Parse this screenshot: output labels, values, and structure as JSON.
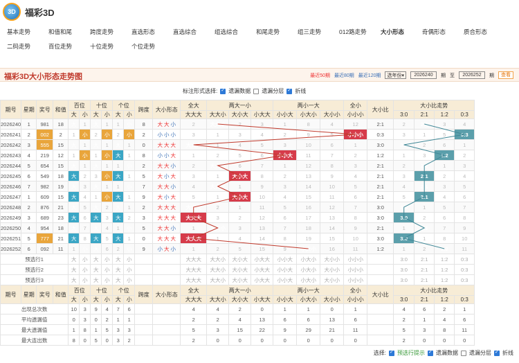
{
  "brand": {
    "logo": "3D",
    "name": "福彩3D"
  },
  "nav": [
    "基本走势",
    "和值和尾",
    "跨度走势",
    "直选形态",
    "直选综合",
    "组选综合",
    "和尾走势",
    "组三走势",
    "012路走势",
    "大小形态",
    "奇偶形态",
    "质合形态",
    "二码走势",
    "百位走势",
    "十位走势",
    "个位走势"
  ],
  "nav_active": 9,
  "page_title": "福彩3D大小形态走势图",
  "filters": {
    "recent50": "最近50期",
    "recent80": "最近80期",
    "recent120": "最近120期",
    "select": "选年份",
    "from": "2026240",
    "qi1": "期",
    "to_label": "至",
    "to": "2026252",
    "qi2": "期",
    "query": "查看"
  },
  "label_form": {
    "label": "标注形式选择:",
    "opt1": "遗漏数据",
    "opt2": "遗漏分层",
    "opt3": "折线"
  },
  "header": {
    "issue": "期号",
    "week": "星期",
    "prize": "奖号",
    "sum": "和值",
    "hundred": "百位",
    "ten": "十位",
    "unit": "个位",
    "span": "跨度",
    "shape": "大小形态",
    "all_big": "全大",
    "two_big_one_small": "两大一小",
    "two_small_one_big": "两小一大",
    "all_small": "全小",
    "ratio": "大小比",
    "ratio_trend": "大小比走势",
    "big": "大",
    "small": "小"
  },
  "shape_cols": [
    "大大大",
    "大大小",
    "大小大",
    "小大大",
    "小小大",
    "小大小",
    "大小小",
    "小小小"
  ],
  "ratio_cols": [
    "3:0",
    "2:1",
    "1:2",
    "0:3"
  ],
  "rows": [
    {
      "issue": "2026240",
      "week": "1",
      "prize": "981",
      "sum": "18",
      "h": [
        "大",
        "1"
      ],
      "t": [
        "大",
        "1"
      ],
      "u": [
        "1",
        "小"
      ],
      "span": "8",
      "shape": [
        "大",
        "大",
        "小"
      ],
      "sc": [
        "2",
        "大大小",
        "2",
        "3",
        "1",
        "8",
        "4",
        "12"
      ],
      "ratio": "2:1",
      "rt": [
        "2",
        "2:1",
        "3",
        "4"
      ]
    },
    {
      "issue": "2026241",
      "week": "2",
      "prize": "002",
      "sum": "2",
      "h": [
        "1",
        "小"
      ],
      "t": [
        "2",
        "小"
      ],
      "u": [
        "2",
        "小"
      ],
      "span": "2",
      "shape": [
        "小",
        "小",
        "小"
      ],
      "sc": [
        "3",
        "1",
        "3",
        "4",
        "2",
        "9",
        "5",
        "小小小"
      ],
      "ratio": "0:3",
      "rt": [
        "3",
        "1",
        "5",
        "0:3"
      ]
    },
    {
      "issue": "2026242",
      "week": "3",
      "prize": "555",
      "sum": "15",
      "h": [
        "大",
        "1"
      ],
      "t": [
        "大",
        "1"
      ],
      "u": [
        "大",
        "1"
      ],
      "span": "0",
      "shape": [
        "大",
        "大",
        "大"
      ],
      "sc": [
        "大大大",
        "1",
        "4",
        "5",
        "3",
        "10",
        "6",
        "1"
      ],
      "ratio": "3:0",
      "rt": [
        "3:0",
        "2",
        "6",
        "1"
      ]
    },
    {
      "issue": "2026243",
      "week": "4",
      "prize": "219",
      "sum": "12",
      "h": [
        "1",
        "小"
      ],
      "t": [
        "1",
        "小"
      ],
      "u": [
        "大",
        "1"
      ],
      "span": "8",
      "shape": [
        "小",
        "小",
        "大"
      ],
      "sc": [
        "1",
        "2",
        "5",
        "6",
        "小小大",
        "11",
        "7",
        "2"
      ],
      "ratio": "1:2",
      "rt": [
        "1",
        "3",
        "1:2",
        "2"
      ]
    },
    {
      "issue": "2026244",
      "week": "5",
      "prize": "654",
      "sum": "15",
      "h": [
        "大",
        "1"
      ],
      "t": [
        "大",
        "1"
      ],
      "u": [
        "1",
        "小"
      ],
      "span": "2",
      "shape": [
        "大",
        "大",
        "小"
      ],
      "sc": [
        "2",
        "大大小",
        "6",
        "7",
        "1",
        "12",
        "8",
        "3"
      ],
      "ratio": "2:1",
      "rt": [
        "2",
        "2:1",
        "1",
        "3"
      ]
    },
    {
      "issue": "2026245",
      "week": "6",
      "prize": "549",
      "sum": "18",
      "h": [
        "大",
        "2"
      ],
      "t": [
        "3",
        "小"
      ],
      "u": [
        "大",
        "1"
      ],
      "span": "5",
      "shape": [
        "大",
        "小",
        "大"
      ],
      "sc": [
        "3",
        "1",
        "大小大",
        "8",
        "2",
        "13",
        "9",
        "4"
      ],
      "ratio": "2:1",
      "rt": [
        "3",
        "2:1",
        "2",
        "4"
      ]
    },
    {
      "issue": "2026246",
      "week": "7",
      "prize": "982",
      "sum": "19",
      "h": [
        "大",
        "3"
      ],
      "t": [
        "大",
        "1"
      ],
      "u": [
        "1",
        "小"
      ],
      "span": "7",
      "shape": [
        "大",
        "大",
        "小"
      ],
      "sc": [
        "4",
        "大大小",
        "1",
        "9",
        "3",
        "14",
        "10",
        "5"
      ],
      "ratio": "2:1",
      "rt": [
        "4",
        "2:1",
        "3",
        "5"
      ]
    },
    {
      "issue": "2026247",
      "week": "1",
      "prize": "609",
      "sum": "15",
      "h": [
        "大",
        "4"
      ],
      "t": [
        "1",
        "小"
      ],
      "u": [
        "大",
        "1"
      ],
      "span": "9",
      "shape": [
        "大",
        "小",
        "大"
      ],
      "sc": [
        "5",
        "1",
        "大小大",
        "10",
        "4",
        "15",
        "11",
        "6"
      ],
      "ratio": "2:1",
      "rt": [
        "5",
        "2:1",
        "4",
        "6"
      ]
    },
    {
      "issue": "2026248",
      "week": "2",
      "prize": "876",
      "sum": "21",
      "h": [
        "大",
        "5"
      ],
      "t": [
        "大",
        "2"
      ],
      "u": [
        "大",
        "1"
      ],
      "span": "2",
      "shape": [
        "大",
        "大",
        "大"
      ],
      "sc": [
        "大大大",
        "2",
        "1",
        "11",
        "5",
        "16",
        "12",
        "7"
      ],
      "ratio": "3:0",
      "rt": [
        "3:0",
        "1",
        "5",
        "7"
      ]
    },
    {
      "issue": "2026249",
      "week": "3",
      "prize": "689",
      "sum": "23",
      "h": [
        "大",
        "6"
      ],
      "t": [
        "大",
        "3"
      ],
      "u": [
        "大",
        "2"
      ],
      "span": "3",
      "shape": [
        "大",
        "大",
        "大"
      ],
      "sc": [
        "大大大",
        "3",
        "2",
        "12",
        "6",
        "17",
        "13",
        "8"
      ],
      "ratio": "3:0",
      "rt": [
        "3:0",
        "2",
        "6",
        "8"
      ]
    },
    {
      "issue": "2026250",
      "week": "4",
      "prize": "954",
      "sum": "18",
      "h": [
        "大",
        "7"
      ],
      "t": [
        "大",
        "4"
      ],
      "u": [
        "1",
        "小"
      ],
      "span": "5",
      "shape": [
        "大",
        "大",
        "小"
      ],
      "sc": [
        "1",
        "大大小",
        "3",
        "13",
        "7",
        "18",
        "14",
        "9"
      ],
      "ratio": "2:1",
      "rt": [
        "1",
        "2:1",
        "7",
        "9"
      ]
    },
    {
      "issue": "2026251",
      "week": "5",
      "prize": "777",
      "sum": "21",
      "h": [
        "大",
        "8"
      ],
      "t": [
        "大",
        "5"
      ],
      "u": [
        "大",
        "1"
      ],
      "span": "0",
      "shape": [
        "大",
        "大",
        "大"
      ],
      "sc": [
        "大大大",
        "1",
        "4",
        "14",
        "8",
        "19",
        "15",
        "10"
      ],
      "ratio": "3:0",
      "rt": [
        "3:0",
        "1",
        "8",
        "10"
      ]
    },
    {
      "issue": "2026252",
      "week": "6",
      "prize": "092",
      "sum": "11",
      "h": [
        "1",
        "小"
      ],
      "t": [
        "大",
        "6"
      ],
      "u": [
        "2",
        "小"
      ],
      "span": "9",
      "shape": [
        "小",
        "大",
        "小"
      ],
      "sc": [
        "1",
        "2",
        "5",
        "15",
        "9",
        "小大小",
        "16",
        "11"
      ],
      "ratio": "1:2",
      "rt": [
        "1",
        "2",
        "1:2",
        "11"
      ]
    }
  ],
  "highlight_prize": [
    1,
    2,
    11
  ],
  "pred_rows": [
    "预选行1",
    "预选行2",
    "预选行3"
  ],
  "stats": [
    {
      "label": "出现总次数",
      "d": [
        "10",
        "3",
        "9",
        "4",
        "7",
        "6"
      ],
      "sc": [
        "4",
        "4",
        "2",
        "0",
        "1",
        "1",
        "0",
        "1"
      ],
      "rt": [
        "4",
        "6",
        "2",
        "1"
      ]
    },
    {
      "label": "平均遗漏值",
      "d": [
        "0",
        "3",
        "0",
        "2",
        "1",
        "1"
      ],
      "sc": [
        "2",
        "2",
        "4",
        "13",
        "6",
        "6",
        "13",
        "6"
      ],
      "rt": [
        "2",
        "1",
        "4",
        "6"
      ]
    },
    {
      "label": "最大遗漏值",
      "d": [
        "1",
        "8",
        "1",
        "5",
        "3",
        "3"
      ],
      "sc": [
        "5",
        "3",
        "15",
        "22",
        "9",
        "29",
        "21",
        "11"
      ],
      "rt": [
        "5",
        "3",
        "8",
        "11"
      ]
    },
    {
      "label": "最大连出数",
      "d": [
        "8",
        "0",
        "5",
        "0",
        "3",
        "2"
      ],
      "sc": [
        "2",
        "0",
        "0",
        "0",
        "0",
        "0",
        "0",
        "0"
      ],
      "rt": [
        "2",
        "0",
        "0",
        "0"
      ]
    }
  ],
  "footer": {
    "select": "选择:",
    "opt1": "预选行提示",
    "opt2": "遗漏数据",
    "opt3": "遗漏分层",
    "opt4": "折线"
  }
}
